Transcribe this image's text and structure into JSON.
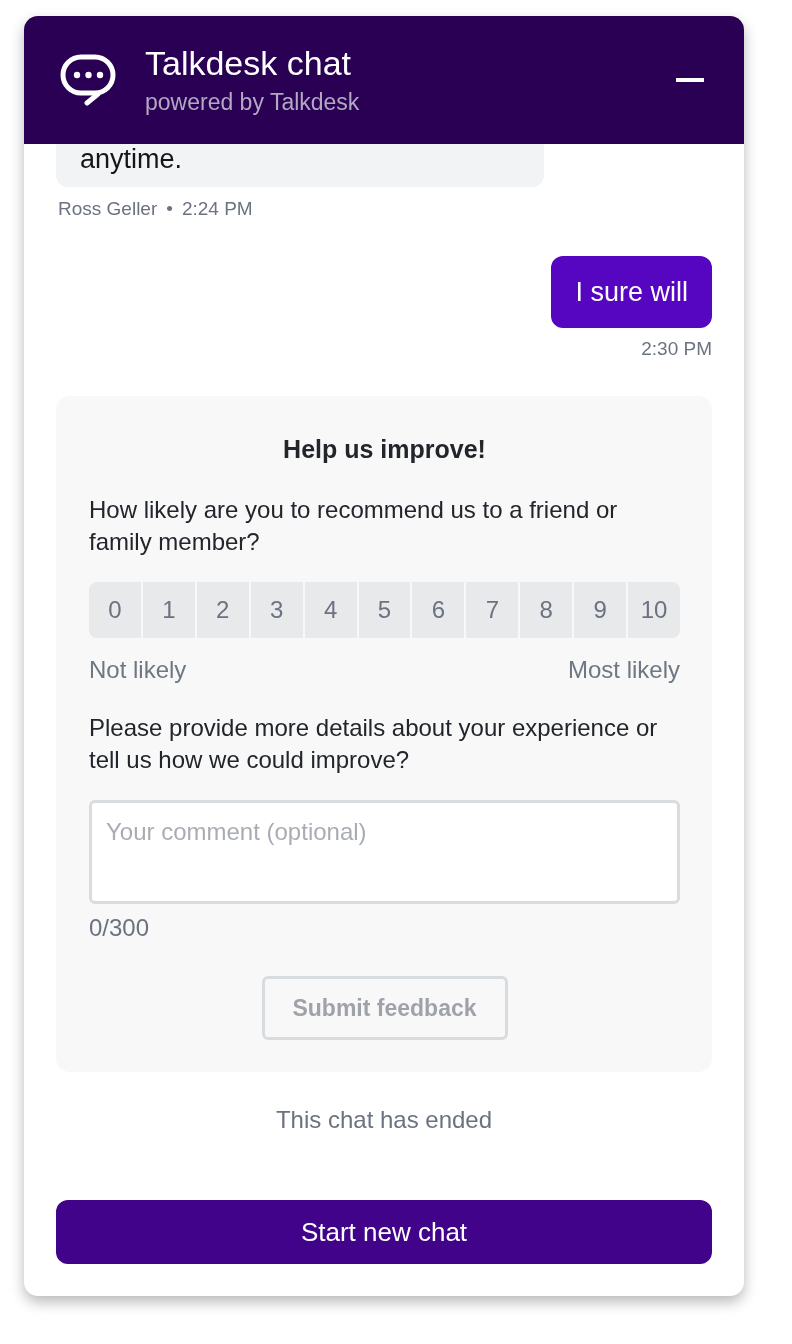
{
  "header": {
    "title": "Talkdesk chat",
    "subtitle": "powered by Talkdesk"
  },
  "messages": [
    {
      "kind": "incoming",
      "text": "anytime.",
      "author": "Ross Geller",
      "separator": "•",
      "time": "2:24 PM"
    },
    {
      "kind": "outgoing",
      "text": "I sure will",
      "time": "2:30 PM"
    }
  ],
  "survey": {
    "title": "Help us improve!",
    "question": "How likely are you to recommend us to a friend or family member?",
    "scale": [
      {
        "label": "0",
        "selected": false
      },
      {
        "label": "1",
        "selected": false
      },
      {
        "label": "2",
        "selected": false
      },
      {
        "label": "3",
        "selected": false
      },
      {
        "label": "4",
        "selected": false
      },
      {
        "label": "5",
        "selected": false
      },
      {
        "label": "6",
        "selected": false
      },
      {
        "label": "7",
        "selected": false
      },
      {
        "label": "8",
        "selected": false
      },
      {
        "label": "9",
        "selected": false
      },
      {
        "label": "10",
        "selected": false
      }
    ],
    "low_label": "Not likely",
    "high_label": "Most likely",
    "comment_question": "Please provide more details about your experience or tell us how we could improve?",
    "comment": {
      "placeholder": "Your comment (optional)",
      "counter": "0/300"
    },
    "submit": {
      "label": "Submit feedback",
      "disabled": true
    }
  },
  "status": "This chat has ended",
  "start_button": "Start new chat"
}
